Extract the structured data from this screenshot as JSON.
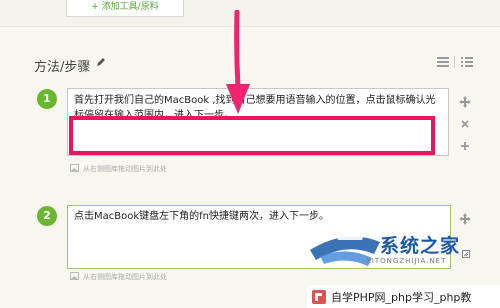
{
  "toolbar": {
    "add_tool_label": "+ 添加工具/原料"
  },
  "section": {
    "title": "方法/步骤"
  },
  "steps": [
    {
      "number": "1",
      "text": "首先打开我们自己的MacBook ,找到自己想要用语音输入的位置，点击鼠标确认光标停留在输入范围内，进入下一步。",
      "image_hint": "从右侧图库拖动图片到此处"
    },
    {
      "number": "2",
      "text": "点击MacBook键盘左下角的fn快捷键两次，进入下一步。",
      "image_hint": "从右侧图库拖动图片到此处"
    }
  ],
  "watermark": {
    "title": "系统之家",
    "subtitle": "XITONGZHIJIA.NET"
  },
  "footer": {
    "text": "自学PHP网_php学习_php教"
  },
  "colors": {
    "accent_green": "#6bb630",
    "highlight_red": "#ee1560",
    "arrow_pink": "#f0246f",
    "brand_blue": "#1a5aa8"
  }
}
